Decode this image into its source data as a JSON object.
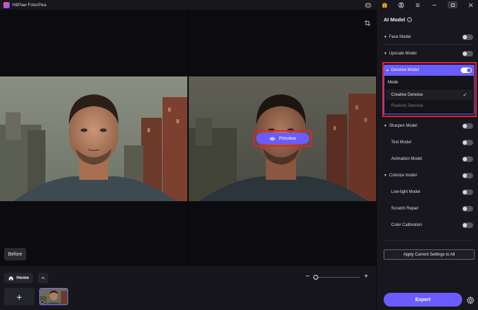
{
  "app": {
    "title": "HitPaw FotorPea"
  },
  "titlebar": {
    "icons": [
      "discord-icon",
      "gift-icon",
      "account-icon",
      "menu-icon",
      "minimize-icon",
      "maximize-icon",
      "close-icon"
    ]
  },
  "canvas": {
    "before_label": "Before",
    "preview_label": "Preview"
  },
  "bottom": {
    "home_label": "Home",
    "add_symbol": "+",
    "zoom_minus": "−",
    "zoom_plus": "+",
    "zoom_level": 0.02
  },
  "panel": {
    "title": "AI Model",
    "models": [
      {
        "label": "Face Model",
        "enabled": false,
        "expandable": true
      },
      {
        "label": "Upscale Model",
        "enabled": false,
        "expandable": true
      },
      {
        "label": "Denoise Model",
        "enabled": true,
        "expandable": true,
        "expanded": true
      },
      {
        "label": "Sharpen Model",
        "enabled": false,
        "expandable": true
      },
      {
        "label": "Text Model",
        "enabled": false,
        "expandable": false
      },
      {
        "label": "Animation Model",
        "enabled": false,
        "expandable": false
      },
      {
        "label": "Colorize model",
        "enabled": false,
        "expandable": true
      },
      {
        "label": "Low-light Model",
        "enabled": false,
        "expandable": false
      },
      {
        "label": "Scratch Repair",
        "enabled": false,
        "expandable": false
      },
      {
        "label": "Color Calibration",
        "enabled": false,
        "expandable": false
      }
    ],
    "denoise": {
      "mode_label": "Mode",
      "options": [
        {
          "label": "Creative Denoise",
          "selected": true
        },
        {
          "label": "Realistic Denoise",
          "selected": false
        }
      ]
    },
    "apply_label": "Apply Current Settings to All",
    "export_label": "Export"
  },
  "colors": {
    "accent": "#6a5cff",
    "highlight_frame": "#e0232d",
    "panel_bg": "#17171d"
  }
}
